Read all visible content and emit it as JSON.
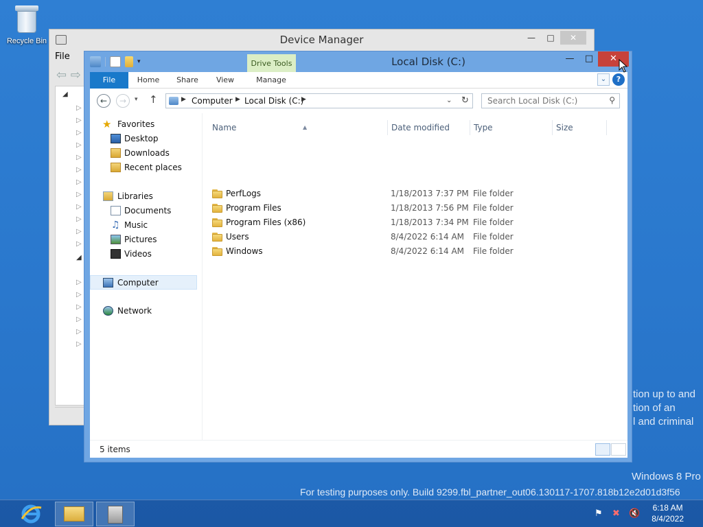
{
  "desktop": {
    "recycle_bin_label": "Recycle Bin",
    "watermark_line1": "tion up to and",
    "watermark_line2": "tion of an",
    "watermark_line3": "l and criminal",
    "os_name": "Windows 8 Pro",
    "build_text": "For testing purposes only. Build 9299.fbl_partner_out06.130117-1707.818b12e2d01d3f56"
  },
  "device_manager": {
    "title": "Device Manager",
    "menu_file": "File"
  },
  "explorer": {
    "title": "Local Disk (C:)",
    "contextual_tab_group": "Drive Tools",
    "ribbon_tabs": [
      "File",
      "Home",
      "Share",
      "View",
      "Manage"
    ],
    "breadcrumb": [
      "Computer",
      "Local Disk (C:)"
    ],
    "search_placeholder": "Search Local Disk (C:)",
    "nav": {
      "favorites": "Favorites",
      "desktop": "Desktop",
      "downloads": "Downloads",
      "recent_places": "Recent places",
      "libraries": "Libraries",
      "documents": "Documents",
      "music": "Music",
      "pictures": "Pictures",
      "videos": "Videos",
      "computer": "Computer",
      "network": "Network"
    },
    "columns": [
      "Name",
      "Date modified",
      "Type",
      "Size"
    ],
    "files": [
      {
        "name": "PerfLogs",
        "date": "1/18/2013 7:37 PM",
        "type": "File folder"
      },
      {
        "name": "Program Files",
        "date": "1/18/2013 7:56 PM",
        "type": "File folder"
      },
      {
        "name": "Program Files (x86)",
        "date": "1/18/2013 7:34 PM",
        "type": "File folder"
      },
      {
        "name": "Users",
        "date": "8/4/2022 6:14 AM",
        "type": "File folder"
      },
      {
        "name": "Windows",
        "date": "8/4/2022 6:14 AM",
        "type": "File folder"
      }
    ],
    "status_count": "5 items"
  },
  "taskbar": {
    "time": "6:18 AM",
    "date": "8/4/2022"
  },
  "colors": {
    "desktop_blue": "#2a78cd",
    "file_tab_blue": "#1979ca",
    "close_red": "#c7423a",
    "drive_tools_green": "#dbeec5"
  }
}
